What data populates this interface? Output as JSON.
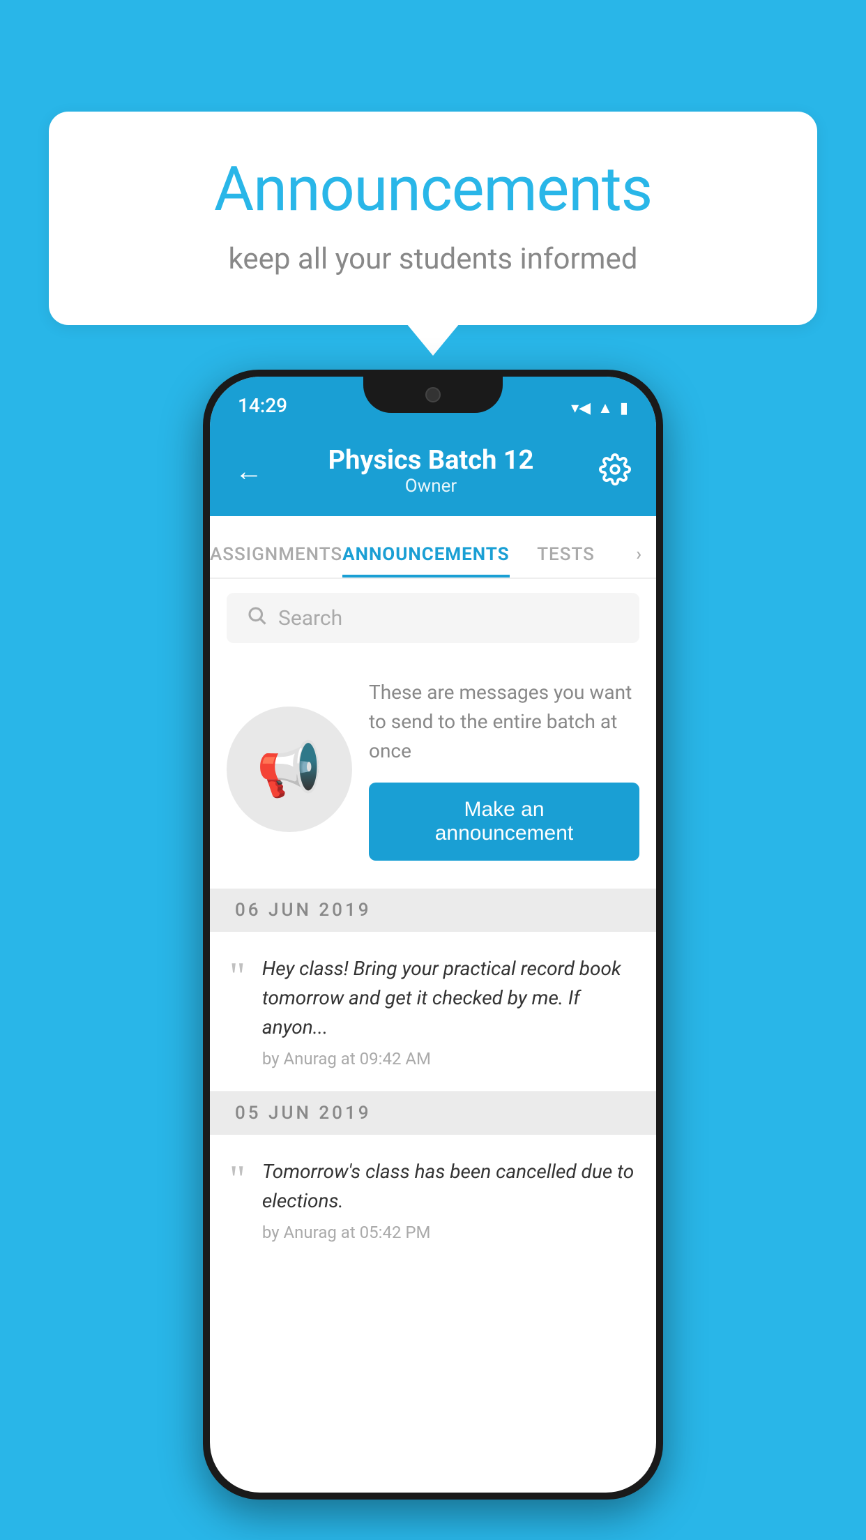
{
  "background_color": "#29b6e8",
  "speech_bubble": {
    "title": "Announcements",
    "subtitle": "keep all your students informed"
  },
  "phone": {
    "status_bar": {
      "time": "14:29",
      "wifi": "▾",
      "signal": "▲",
      "battery": "▮"
    },
    "header": {
      "title": "Physics Batch 12",
      "subtitle": "Owner",
      "back_label": "←",
      "settings_label": "⚙"
    },
    "tabs": [
      {
        "label": "ASSIGNMENTS",
        "active": false
      },
      {
        "label": "ANNOUNCEMENTS",
        "active": true
      },
      {
        "label": "TESTS",
        "active": false
      },
      {
        "label": "›",
        "active": false
      }
    ],
    "search": {
      "placeholder": "Search"
    },
    "announcement_promo": {
      "description": "These are messages you want to send to the entire batch at once",
      "button_label": "Make an announcement"
    },
    "announcements": [
      {
        "date": "06  JUN  2019",
        "message": "Hey class! Bring your practical record book tomorrow and get it checked by me. If anyon...",
        "meta": "by Anurag at 09:42 AM"
      },
      {
        "date": "05  JUN  2019",
        "message": "Tomorrow's class has been cancelled due to elections.",
        "meta": "by Anurag at 05:42 PM"
      }
    ]
  }
}
